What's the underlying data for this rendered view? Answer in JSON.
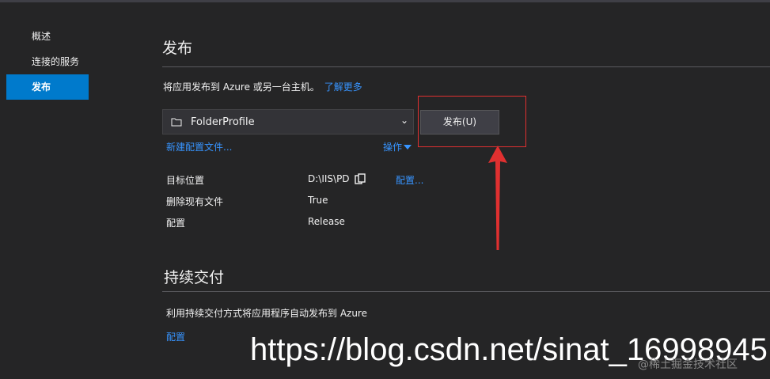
{
  "nav": {
    "items": [
      {
        "label": "概述"
      },
      {
        "label": "连接的服务"
      },
      {
        "label": "发布",
        "active": true
      }
    ]
  },
  "publish": {
    "heading": "发布",
    "description": "将应用发布到 Azure 或另一台主机。",
    "learn_more": "了解更多",
    "profile_value": "FolderProfile",
    "publish_button": "发布(U)",
    "new_profile_link": "新建配置文件...",
    "actions_link": "操作",
    "details": [
      {
        "label": "目标位置",
        "value": "D:\\IIS\\PD"
      },
      {
        "label": "删除现有文件",
        "value": "True"
      },
      {
        "label": "配置",
        "value": "Release"
      }
    ],
    "configure_link": "配置..."
  },
  "cd": {
    "heading": "持续交付",
    "description": "利用持续交付方式将应用程序自动发布到 Azure",
    "configure_link": "配置"
  },
  "watermark": {
    "url": "https://blog.csdn.net/sinat_16998945",
    "site": "@稀土掘金技术社区"
  },
  "colors": {
    "accent": "#007acc",
    "link": "#3794ff",
    "annotation": "#e03030"
  },
  "icons": {
    "profile": "folder-icon",
    "chevron": "chevron-down-icon",
    "copy": "copy-icon"
  }
}
